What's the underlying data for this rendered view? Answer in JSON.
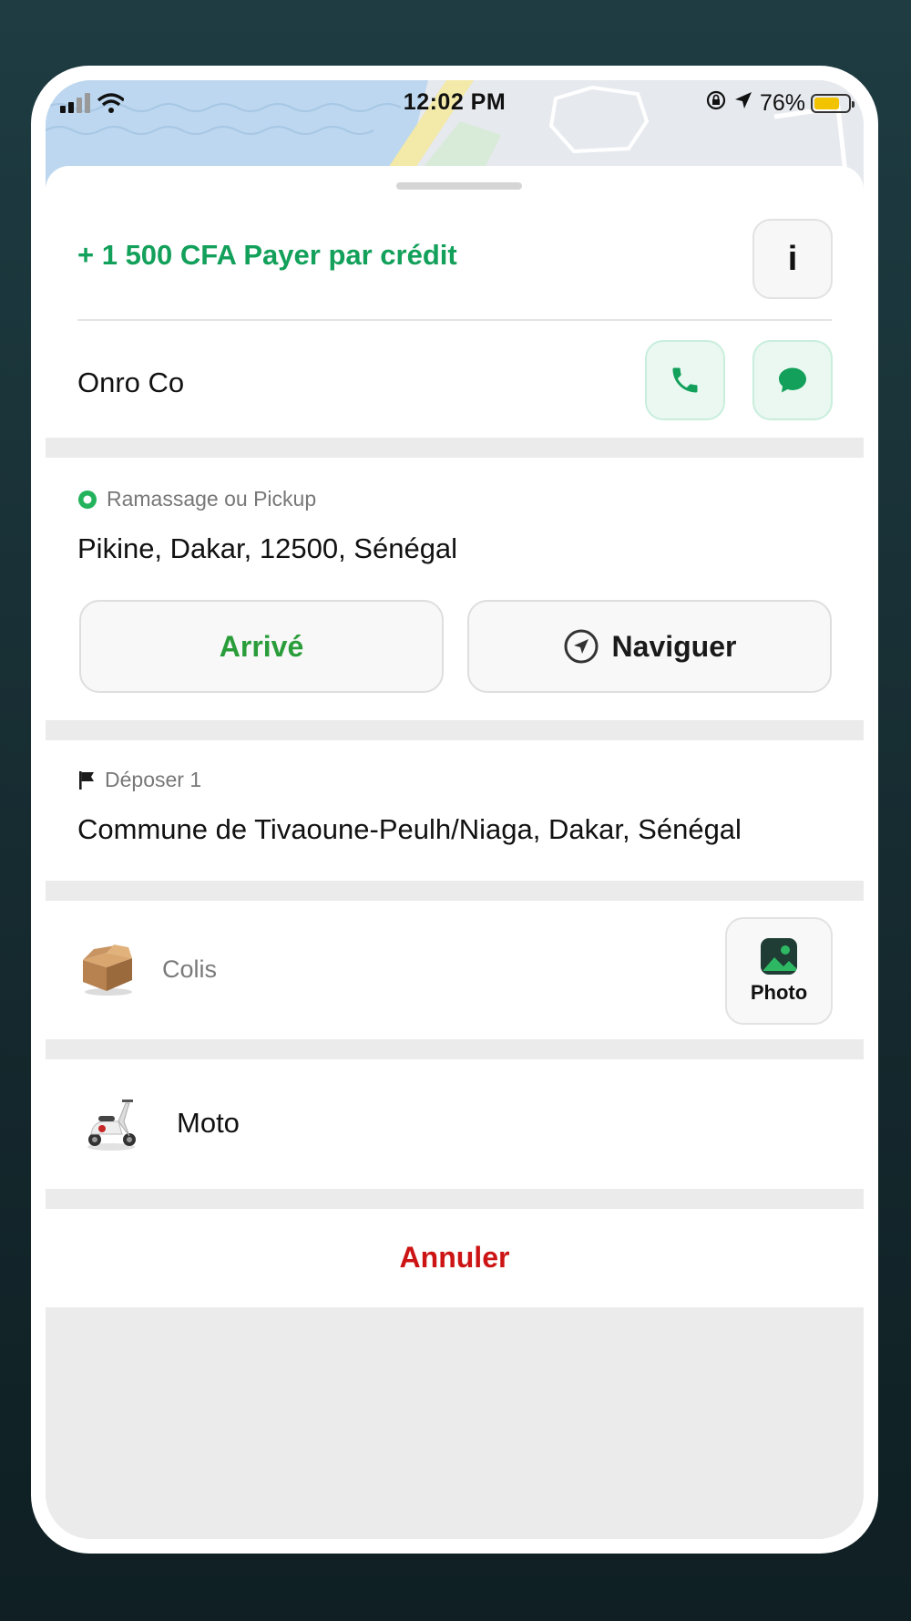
{
  "status_bar": {
    "time": "12:02 PM",
    "battery_percent": "76%",
    "battery_level": 0.76,
    "signal_icon": "cellular-signal-icon",
    "wifi_icon": "wifi-icon",
    "rotation_lock_icon": "rotation-lock-icon",
    "location_icon": "location-arrow-icon"
  },
  "header": {
    "price_text": "+ 1 500 CFA Payer par crédit",
    "info_label": "i"
  },
  "customer": {
    "name": "Onro Co",
    "call_icon": "phone-icon",
    "chat_icon": "chat-bubble-icon"
  },
  "pickup": {
    "label": "Ramassage ou Pickup",
    "address": "Pikine, Dakar, 12500, Sénégal",
    "arrived_label": "Arrivé",
    "navigate_label": "Naviguer"
  },
  "dropoff": {
    "label": "Déposer 1",
    "address": "Commune de Tivaoune-Peulh/Niaga, Dakar, Sénégal"
  },
  "package": {
    "label": "Colis",
    "photo_label": "Photo"
  },
  "vehicle": {
    "label": "Moto"
  },
  "actions": {
    "cancel_label": "Annuler"
  },
  "colors": {
    "brand_green": "#12a05a",
    "arrived_green": "#2a9d3a",
    "cancel_red": "#cc1414"
  }
}
